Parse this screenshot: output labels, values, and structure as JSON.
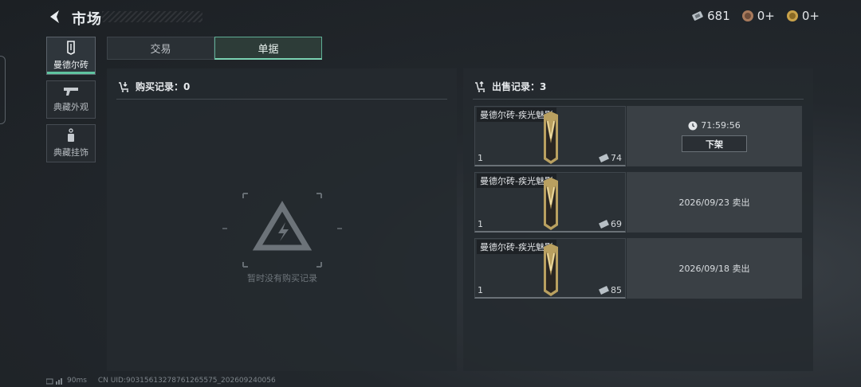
{
  "header": {
    "title": "市场"
  },
  "currencies": [
    {
      "icon": "ticket-icon",
      "value": "681"
    },
    {
      "icon": "bronze-coin-icon",
      "value": "0+"
    },
    {
      "icon": "gold-coin-icon",
      "value": "0+"
    }
  ],
  "sidebar": {
    "items": [
      {
        "label": "曼德尔砖",
        "active": true
      },
      {
        "label": "典藏外观",
        "active": false
      },
      {
        "label": "典藏挂饰",
        "active": false
      }
    ]
  },
  "tabs": [
    {
      "label": "交易",
      "active": false
    },
    {
      "label": "单据",
      "active": true
    }
  ],
  "purchase": {
    "title": "购买记录：0",
    "empty_text": "暂时没有购买记录"
  },
  "sales": {
    "title": "出售记录：3",
    "records": [
      {
        "name": "曼德尔砖-疾光魅影",
        "qty": "1",
        "price": "74",
        "timer": "71:59:56",
        "action": "下架"
      },
      {
        "name": "曼德尔砖-疾光魅影",
        "qty": "1",
        "price": "69",
        "status": "2026/09/23 卖出"
      },
      {
        "name": "曼德尔砖-疾光魅影",
        "qty": "1",
        "price": "85",
        "status": "2026/09/18 卖出"
      }
    ]
  },
  "footer": {
    "ping": "90ms",
    "uid": "CN UID:90315613278761265575_202609240056"
  },
  "colors": {
    "accent": "#5fc3a0",
    "panel": "#242a2f"
  }
}
